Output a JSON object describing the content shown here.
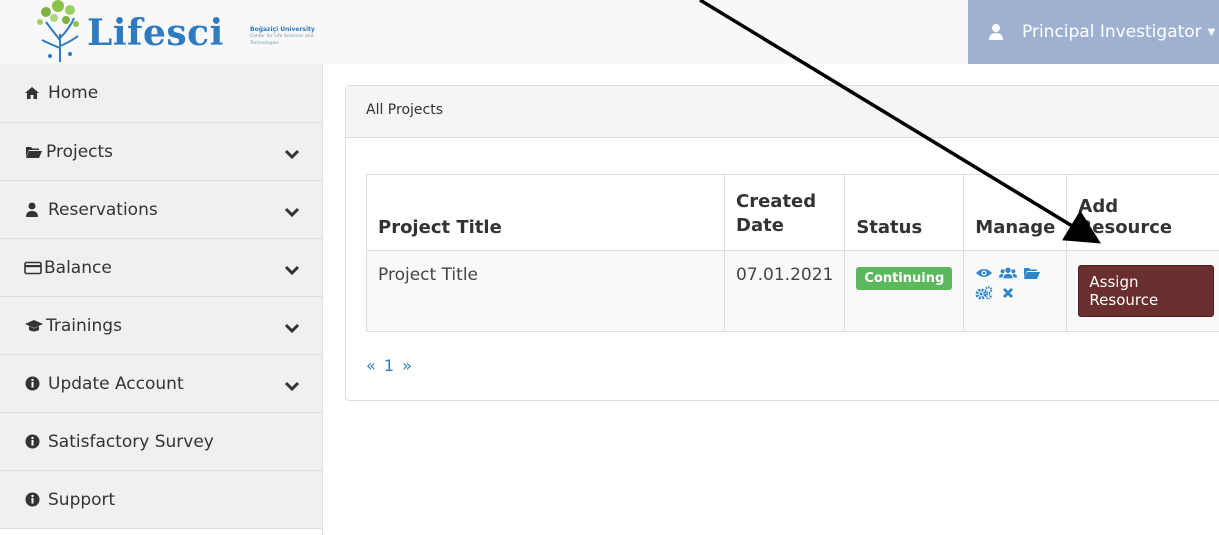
{
  "header": {
    "logo_text": "Lifesci",
    "logo_university": "Boğaziçi University",
    "logo_tagline": "Center for Life Sciences and Technologies",
    "user_menu_label": "Principal Investigator"
  },
  "sidebar": {
    "items": [
      {
        "label": "Home",
        "icon": "home-icon",
        "has_chevron": false
      },
      {
        "label": "Projects",
        "icon": "folder-open-icon",
        "has_chevron": true
      },
      {
        "label": "Reservations",
        "icon": "user-icon",
        "has_chevron": true
      },
      {
        "label": "Balance",
        "icon": "credit-card-icon",
        "has_chevron": true
      },
      {
        "label": "Trainings",
        "icon": "graduation-cap-icon",
        "has_chevron": true
      },
      {
        "label": "Update Account",
        "icon": "info-circle-icon",
        "has_chevron": true
      },
      {
        "label": "Satisfactory Survey",
        "icon": "info-circle-icon",
        "has_chevron": false
      },
      {
        "label": "Support",
        "icon": "info-circle-icon",
        "has_chevron": false
      }
    ]
  },
  "panel": {
    "heading": "All Projects",
    "table": {
      "headers": [
        "Project Title",
        "Created Date",
        "Status",
        "Manage",
        "Add Resource"
      ],
      "rows": [
        {
          "title": "Project Title",
          "created": "07.01.2021",
          "status": "Continuing",
          "manage_icons": [
            "eye-icon",
            "users-icon",
            "folder-open-icon",
            "cogs-icon",
            "close-icon"
          ],
          "action_label": "Assign Resource"
        }
      ]
    },
    "pager": {
      "prev": "«",
      "page": "1",
      "next": "»"
    }
  },
  "colors": {
    "brand_blue": "#2e7bbf",
    "user_menu_bg": "#9fb1d1",
    "status_green": "#5cb85c",
    "assign_button": "#6b2e2e"
  }
}
